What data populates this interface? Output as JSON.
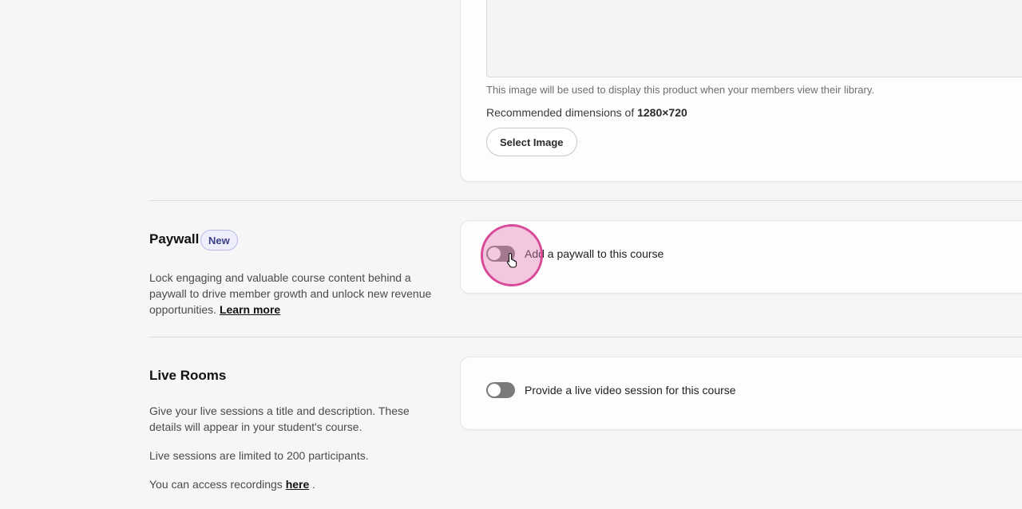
{
  "image_section": {
    "help_text": "This image will be used to display this product when your members view their library.",
    "recommended_prefix": "Recommended dimensions of ",
    "recommended_value": "1280×720",
    "select_button": "Select Image"
  },
  "paywall": {
    "title": "Paywall",
    "badge": "New",
    "description": "Lock engaging and valuable course content behind a paywall to drive member growth and unlock new revenue opportunities.",
    "learn_more": "Learn more",
    "toggle_label": "Add a paywall to this course",
    "toggle_on": false
  },
  "live_rooms": {
    "title": "Live Rooms",
    "description": "Give your live sessions a title and description. These details will appear in your student's course.",
    "limit_text": "Live sessions are limited to 200 participants.",
    "recordings_prefix": "You can access recordings ",
    "recordings_link": "here",
    "recordings_suffix": " .",
    "toggle_label": "Provide a live video session for this course",
    "toggle_on": false
  },
  "colors": {
    "highlight": "#d94a97",
    "toggle_off": "#7a7a7a"
  }
}
